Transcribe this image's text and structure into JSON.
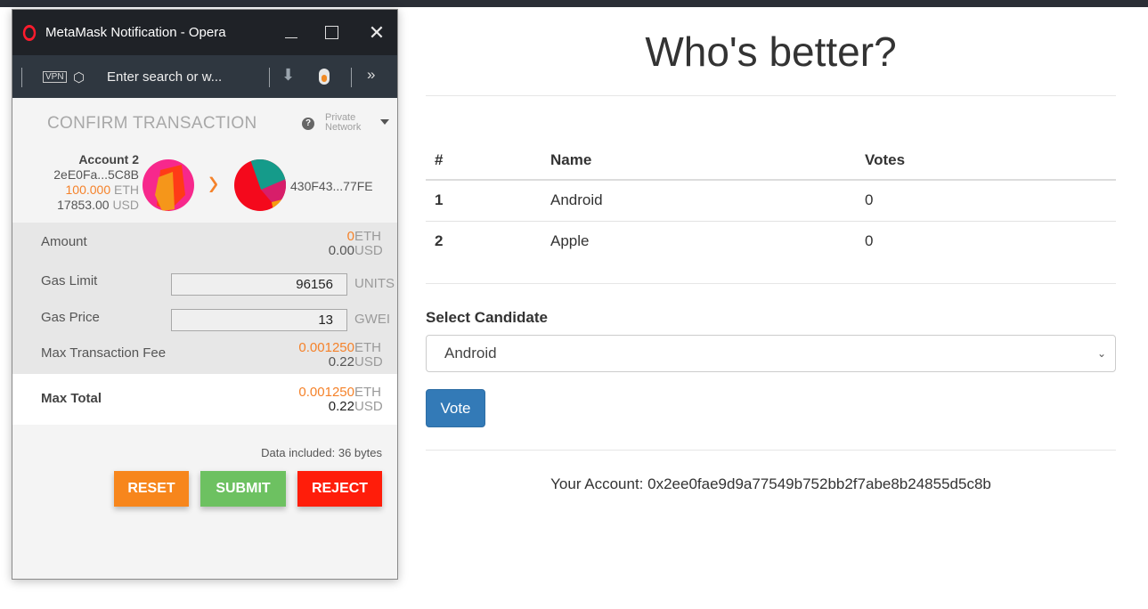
{
  "dapp": {
    "title": "Who's better?",
    "table": {
      "headers": [
        "#",
        "Name",
        "Votes"
      ],
      "rows": [
        {
          "num": "1",
          "name": "Android",
          "votes": "0"
        },
        {
          "num": "2",
          "name": "Apple",
          "votes": "0"
        }
      ]
    },
    "select_label": "Select Candidate",
    "select_value": "Android",
    "vote_label": "Vote",
    "account_line": "Your Account: 0x2ee0fae9d9a77549b752bb2f7abe8b24855d5c8b"
  },
  "popup": {
    "window_title": "MetaMask Notification - Opera",
    "addressbar": {
      "vpn_label": "VPN",
      "placeholder": "Enter search or w..."
    },
    "header": {
      "title": "CONFIRM TRANSACTION",
      "network_line1": "Private",
      "network_line2": "Network"
    },
    "from": {
      "name": "Account 2",
      "address": "2eE0Fa...5C8B",
      "eth_balance": "100.000",
      "eth_unit": "ETH",
      "usd_balance": "17853.00",
      "usd_unit": "USD"
    },
    "to": {
      "address": "430F43...77FE"
    },
    "amount": {
      "label": "Amount",
      "eth": "0",
      "eth_unit": "ETH",
      "usd": "0.00",
      "usd_unit": "USD"
    },
    "gas_limit": {
      "label": "Gas Limit",
      "value": "96156",
      "unit": "UNITS"
    },
    "gas_price": {
      "label": "Gas Price",
      "value": "13",
      "unit": "GWEI"
    },
    "max_fee": {
      "label": "Max Transaction Fee",
      "eth": "0.001250",
      "eth_unit": "ETH",
      "usd": "0.22",
      "usd_unit": "USD"
    },
    "max_total": {
      "label": "Max Total",
      "eth": "0.001250",
      "eth_unit": "ETH",
      "usd": "0.22",
      "usd_unit": "USD"
    },
    "data_included": "Data included: 36 bytes",
    "buttons": {
      "reset": "RESET",
      "submit": "SUBMIT",
      "reject": "REJECT"
    }
  },
  "colors": {
    "orange": "#f5822a",
    "reset": "#f7861c",
    "submit": "#6dc161",
    "reject": "#ff1d0a",
    "vote_button": "#337ab7"
  }
}
